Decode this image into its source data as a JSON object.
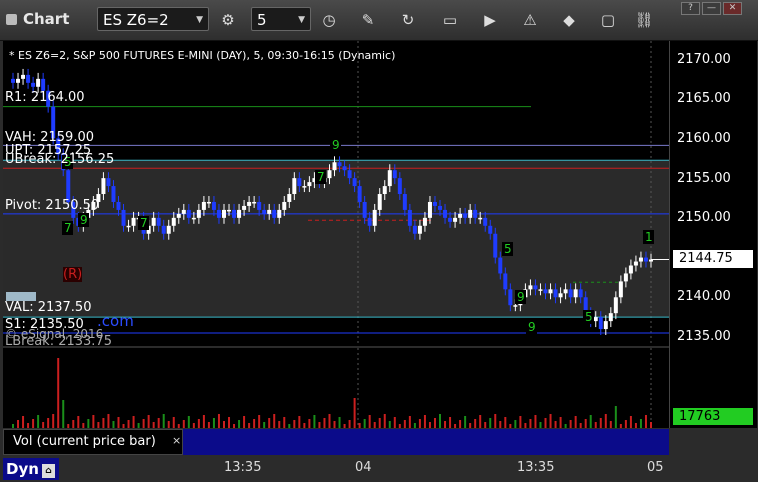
{
  "titlebar": {
    "app_title": "Chart",
    "symbol": "ES Z6=2",
    "interval": "5",
    "icons": [
      "settings-icon",
      "clock-icon",
      "pencil-icon",
      "refresh-icon",
      "quote-icon",
      "play-icon",
      "alert-icon",
      "eraser-icon",
      "comment-icon",
      "link-icon"
    ],
    "window_buttons": [
      "?",
      "—",
      "✕"
    ]
  },
  "chart": {
    "header": "* ES Z6=2, S&P 500 FUTURES E-MINI (DAY), 5, 09:30-16:15 (Dynamic)",
    "levels": {
      "r1": "R1: 2164.00",
      "vah": "VAH: 2159.00",
      "upt": "UPT: 2157.25",
      "ubreak": "UBreak: 2156.25",
      "pivot": "Pivot: 2150.50",
      "val": "VAL: 2137.50",
      "s1": "S1: 2135.50",
      "lbreak": "LBreak: 2133.75"
    },
    "watermark": "© eSignal, 2016",
    "watermark_link": ".com",
    "marker_r": "(R)",
    "price_axis": [
      "2170.00",
      "2165.00",
      "2160.00",
      "2155.00",
      "2150.00",
      "2145.00",
      "2140.00",
      "2135.00"
    ],
    "last_price": "2144.75",
    "volume_last": "17763",
    "study_tab": "Vol (current price bar)",
    "study_close": "×",
    "dyn_label": "Dyn",
    "time_labels": [
      "13:35",
      "04",
      "13:35",
      "05"
    ],
    "colors": {
      "up_bar": "#ffffff",
      "down_bar": "#1f3cff",
      "r1": "#1a8f1a",
      "pivot": "#1f3cff",
      "ubreak": "#c81e1e",
      "upt": "#39b8c8",
      "volume": "#cc1f1f",
      "setup_digits": "#22cc22"
    }
  },
  "chart_data": {
    "type": "candlestick",
    "title": "ES Z6=2, S&P 500 FUTURES E-MINI (DAY), 5, 09:30-16:15 (Dynamic)",
    "ylim": [
      2133,
      2172
    ],
    "y_ticks": [
      2135,
      2140,
      2145,
      2150,
      2155,
      2160,
      2165,
      2170
    ],
    "last_price": 2144.75,
    "levels": {
      "R1": 2164.0,
      "VAH": 2159.0,
      "UPT": 2157.25,
      "UBreak": 2156.25,
      "Pivot": 2150.5,
      "VAL": 2137.5,
      "S1": 2135.5,
      "LBreak": 2133.75
    },
    "close_series": [
      2167,
      2167.5,
      2168,
      2167,
      2166.5,
      2167.5,
      2166,
      2164,
      2160,
      2158,
      2156,
      2152,
      2150,
      2149,
      2150,
      2151,
      2152,
      2153,
      2155,
      2154,
      2152,
      2151,
      2149,
      2149,
      2150,
      2150,
      2148,
      2149,
      2150,
      2149,
      2148,
      2149,
      2150,
      2150.5,
      2151,
      2150,
      2150,
      2151,
      2152,
      2152,
      2151,
      2150,
      2151,
      2151,
      2150,
      2151,
      2151.5,
      2152,
      2152,
      2151,
      2150.5,
      2151,
      2150,
      2151,
      2152,
      2153,
      2155,
      2154,
      2154,
      2154.5,
      2155,
      2154.5,
      2155,
      2156,
      2157,
      2156.5,
      2156,
      2155,
      2154,
      2152,
      2150,
      2149,
      2151,
      2153,
      2154,
      2156,
      2155,
      2153,
      2151,
      2149,
      2148,
      2149,
      2150,
      2152,
      2151.5,
      2151,
      2150,
      2149.5,
      2150,
      2150.5,
      2150,
      2151,
      2150,
      2150,
      2149,
      2148,
      2145,
      2143,
      2141,
      2139,
      2139,
      2140,
      2141,
      2141.5,
      2141,
      2141,
      2140.5,
      2141,
      2140,
      2140.5,
      2141,
      2140,
      2141,
      2140,
      2138,
      2137,
      2137.5,
      2136,
      2137,
      2138,
      2140,
      2142,
      2143,
      2144,
      2144.5,
      2145,
      2144.5,
      2144.75
    ],
    "volume_last": 17763
  }
}
